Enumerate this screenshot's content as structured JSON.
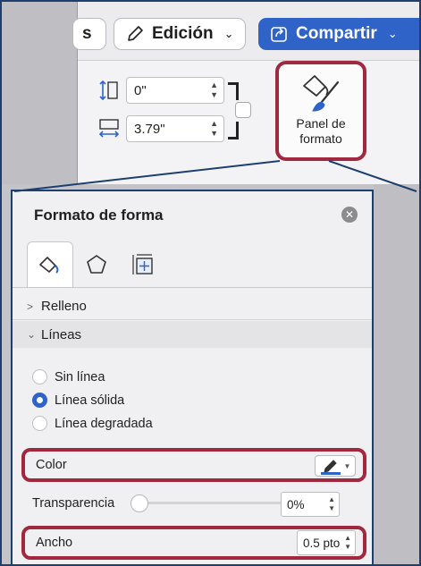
{
  "ribbon": {
    "partial_tab_label": "s",
    "edit_button_label": "Edición",
    "share_button_label": "Compartir",
    "height_value": "0\"",
    "width_value": "3.79\"",
    "format_pane_button_label": "Panel de formato"
  },
  "pane": {
    "title": "Formato de forma",
    "tabs": [
      {
        "icon": "paint-bucket-icon",
        "active": true
      },
      {
        "icon": "pentagon-icon",
        "active": false
      },
      {
        "icon": "size-position-icon",
        "active": false
      }
    ],
    "sections": {
      "fill": {
        "label": "Relleno",
        "expanded": false
      },
      "lines": {
        "label": "Líneas",
        "expanded": true
      }
    },
    "line_options": [
      {
        "label": "Sin línea",
        "selected": false
      },
      {
        "label": "Línea sólida",
        "selected": true
      },
      {
        "label": "Línea degradada",
        "selected": false
      }
    ],
    "color_label": "Color",
    "color_value": "#2f63c7",
    "transparency_label": "Transparencia",
    "transparency_value": "0%",
    "transparency_level": 0,
    "width_label": "Ancho",
    "width_value": "0.5 pto"
  },
  "highlight_color": "#a0283f",
  "accent_color": "#2f63c7"
}
